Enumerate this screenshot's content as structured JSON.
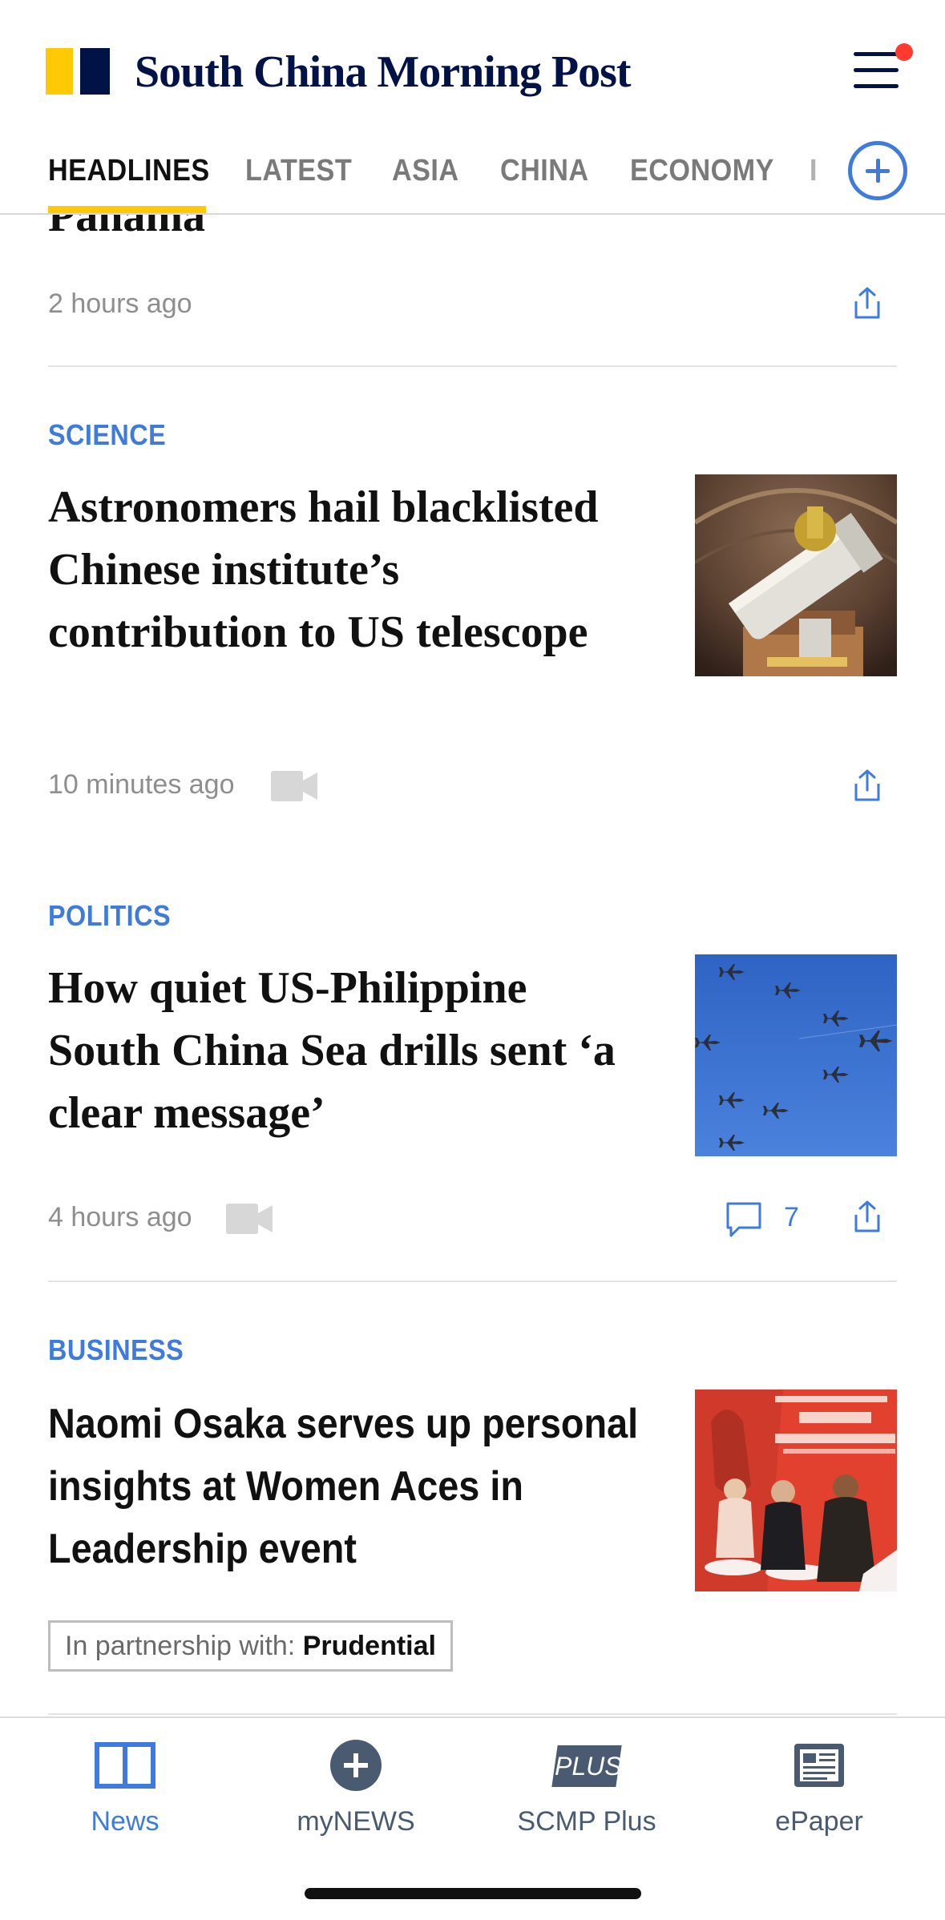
{
  "header": {
    "logo_text": "South China Morning Post",
    "brand_colors": {
      "yellow": "#ffca05",
      "navy": "#001246",
      "accent": "#3e7bdc",
      "notification": "#ff3b30"
    },
    "tabs": [
      {
        "label": "HEADLINES",
        "active": true
      },
      {
        "label": "LATEST"
      },
      {
        "label": "ASIA"
      },
      {
        "label": "CHINA"
      },
      {
        "label": "ECONOMY"
      },
      {
        "label": "I"
      }
    ]
  },
  "articles": [
    {
      "title_partial": "Panama",
      "time": "2 hours ago"
    },
    {
      "section": "SCIENCE",
      "title": "Astronomers hail blacklisted Chinese institute’s contribution to US telescope",
      "time": "10 minutes ago",
      "has_video": true
    },
    {
      "section": "POLITICS",
      "title": "How quiet US-Philippine South China Sea drills sent ‘a clear message’",
      "time": "4 hours ago",
      "has_video": true,
      "comments": "7"
    },
    {
      "section": "BUSINESS",
      "title": "Naomi Osaka serves up personal insights at Women Aces in Leadership event",
      "partner_label": "In partnership with:",
      "partner_name": "Prudential"
    }
  ],
  "bottom_nav": [
    {
      "label": "News",
      "icon": "book-icon",
      "active": true
    },
    {
      "label": "myNEWS",
      "icon": "plus-circle-icon"
    },
    {
      "label": "SCMP Plus",
      "icon": "plus-badge-icon",
      "badge_text": "PLUS"
    },
    {
      "label": "ePaper",
      "icon": "newspaper-icon"
    }
  ]
}
